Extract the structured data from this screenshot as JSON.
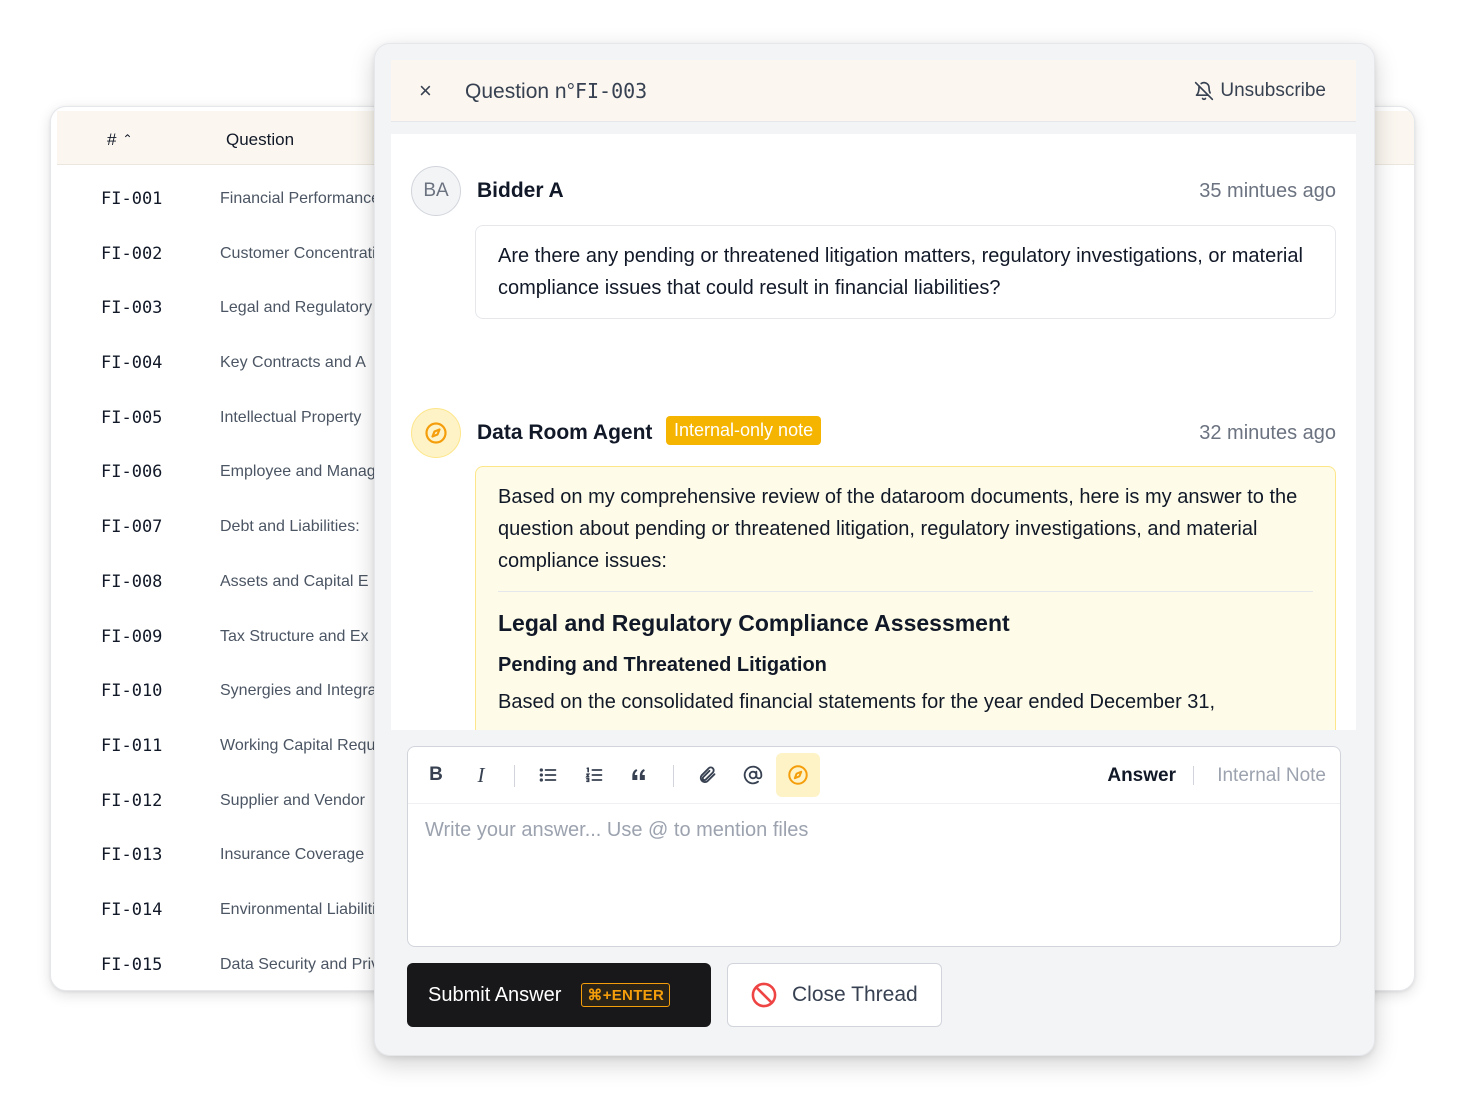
{
  "table": {
    "col_num": "#",
    "col_question": "Question",
    "rows": [
      {
        "id": "FI-001",
        "question": "Financial Performance"
      },
      {
        "id": "FI-002",
        "question": "Customer Concentration"
      },
      {
        "id": "FI-003",
        "question": "Legal and Regulatory"
      },
      {
        "id": "FI-004",
        "question": "Key Contracts and A"
      },
      {
        "id": "FI-005",
        "question": "Intellectual Property"
      },
      {
        "id": "FI-006",
        "question": "Employee and Management"
      },
      {
        "id": "FI-007",
        "question": "Debt and Liabilities:"
      },
      {
        "id": "FI-008",
        "question": "Assets and Capital E"
      },
      {
        "id": "FI-009",
        "question": "Tax Structure and Ex"
      },
      {
        "id": "FI-010",
        "question": "Synergies and Integration"
      },
      {
        "id": "FI-011",
        "question": "Working Capital Requirements"
      },
      {
        "id": "FI-012",
        "question": "Supplier and Vendor"
      },
      {
        "id": "FI-013",
        "question": "Insurance Coverage"
      },
      {
        "id": "FI-014",
        "question": "Environmental Liabilities"
      },
      {
        "id": "FI-015",
        "question": "Data Security and Privacy"
      }
    ]
  },
  "modal": {
    "close_label": "×",
    "title_prefix": "Question n°",
    "title_id": "FI-003",
    "unsubscribe_label": "Unsubscribe"
  },
  "messages": [
    {
      "initials": "BA",
      "author": "Bidder A",
      "time": "35 mintues ago",
      "body": "Are there any pending or threatened litigation matters, regulatory investigations, or material compliance issues that could result in financial liabilities?"
    },
    {
      "author": "Data Room Agent",
      "badge": "Internal-only note",
      "time": "32 minutes ago",
      "intro": "Based on my comprehensive review of the dataroom documents, here is my answer to the question about pending or threatened litigation, regulatory investigations, and material compliance issues:",
      "heading": "Legal and Regulatory Compliance Assessment",
      "subheading": "Pending and Threatened Litigation",
      "paragraph": "Based on the consolidated financial statements for the year ended December 31,"
    }
  ],
  "editor": {
    "bold": "B",
    "italic": "I",
    "mode_answer": "Answer",
    "mode_note": "Internal Note",
    "placeholder": "Write your answer... Use @ to mention files"
  },
  "actions": {
    "submit_label": "Submit Answer",
    "submit_shortcut": "⌘+ENTER",
    "close_label": "Close Thread"
  },
  "colors": {
    "accent": "#f5b400",
    "badge_bg": "#f5b400",
    "agent_bubble_bg": "#fefce8",
    "danger": "#ef4444",
    "submit_bg": "#18181b"
  }
}
